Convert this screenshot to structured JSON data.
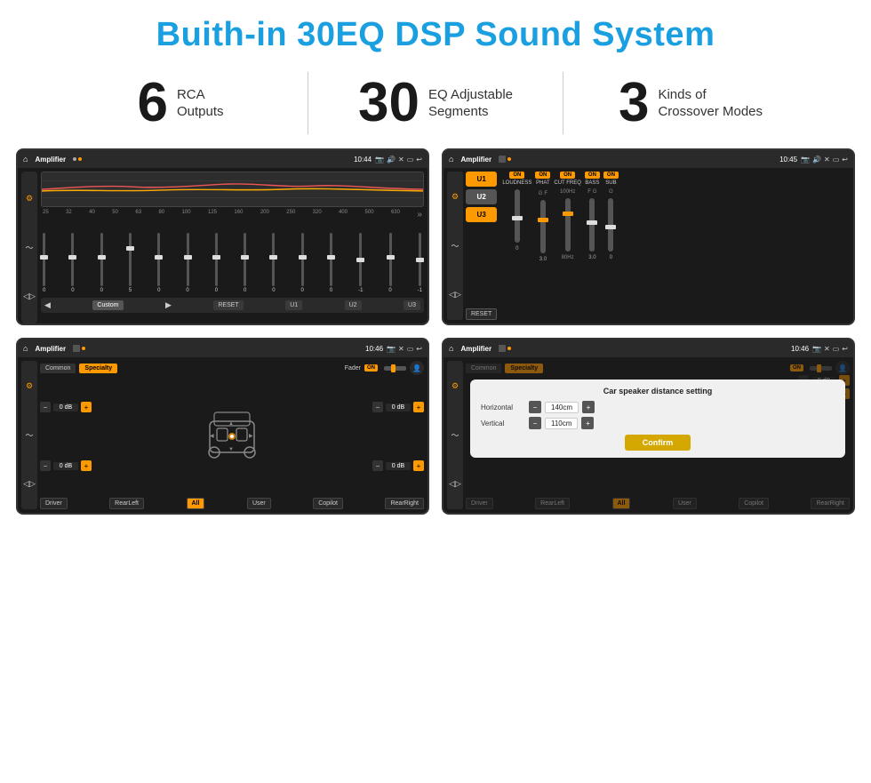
{
  "page": {
    "title": "Buith-in 30EQ DSP Sound System",
    "bg_color": "#ffffff"
  },
  "stats": [
    {
      "number": "6",
      "label_line1": "RCA",
      "label_line2": "Outputs"
    },
    {
      "divider": true
    },
    {
      "number": "30",
      "label_line1": "EQ Adjustable",
      "label_line2": "Segments"
    },
    {
      "divider": true
    },
    {
      "number": "3",
      "label_line1": "Kinds of",
      "label_line2": "Crossover Modes"
    }
  ],
  "screen1": {
    "status": {
      "app": "Amplifier",
      "time": "10:44"
    },
    "eq_labels": [
      "25",
      "32",
      "40",
      "50",
      "63",
      "80",
      "100",
      "125",
      "160",
      "200",
      "250",
      "320",
      "400",
      "500",
      "630"
    ],
    "eq_values": [
      "0",
      "0",
      "0",
      "5",
      "0",
      "0",
      "0",
      "0",
      "0",
      "0",
      "0",
      "-1",
      "0",
      "-1"
    ],
    "buttons": [
      "Custom",
      "RESET",
      "U1",
      "U2",
      "U3"
    ]
  },
  "screen2": {
    "status": {
      "app": "Amplifier",
      "time": "10:45"
    },
    "u_buttons": [
      "U1",
      "U2",
      "U3"
    ],
    "columns": [
      {
        "label": "LOUDNESS",
        "on": true
      },
      {
        "label": "PHAT",
        "on": true
      },
      {
        "label": "CUT FREQ",
        "on": true
      },
      {
        "label": "BASS",
        "on": true
      },
      {
        "label": "SUB",
        "on": true
      }
    ],
    "reset_label": "RESET"
  },
  "screen3": {
    "status": {
      "app": "Amplifier",
      "time": "10:46"
    },
    "tabs": [
      "Common",
      "Specialty"
    ],
    "active_tab": "Specialty",
    "fader_label": "Fader",
    "fader_on": "ON",
    "levels": [
      {
        "label": "",
        "value": "0 dB"
      },
      {
        "label": "",
        "value": "0 dB"
      },
      {
        "label": "",
        "value": "0 dB"
      },
      {
        "label": "",
        "value": "0 dB"
      }
    ],
    "bottom_buttons": [
      "Driver",
      "RearLeft",
      "All",
      "User",
      "Copilot",
      "RearRight"
    ]
  },
  "screen4": {
    "status": {
      "app": "Amplifier",
      "time": "10:46"
    },
    "tabs": [
      "Common",
      "Specialty"
    ],
    "dialog": {
      "title": "Car speaker distance setting",
      "horizontal_label": "Horizontal",
      "horizontal_value": "140cm",
      "vertical_label": "Vertical",
      "vertical_value": "110cm",
      "confirm_label": "Confirm"
    },
    "bottom_buttons": [
      "Driver",
      "RearLeft",
      "All",
      "User",
      "Copilot",
      "RearRight"
    ]
  }
}
